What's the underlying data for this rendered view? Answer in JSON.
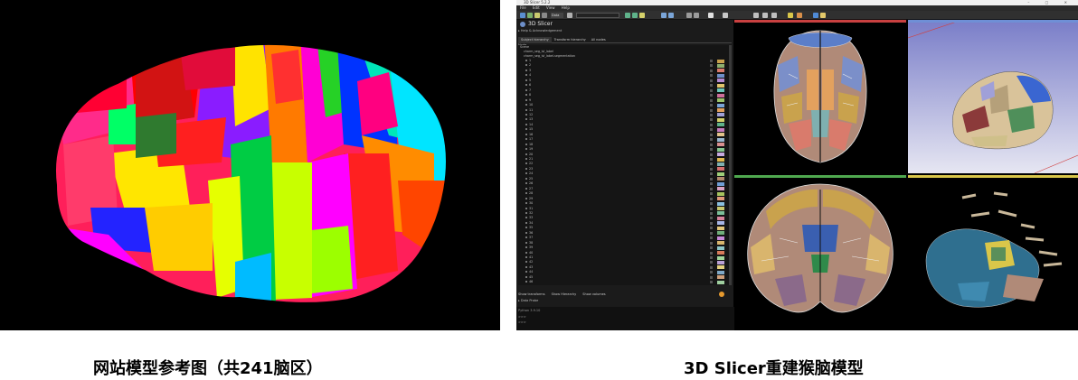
{
  "captions": {
    "left": "网站模型参考图（共241脑区）",
    "right": "3D Slicer重建猴脑模型"
  },
  "slicer": {
    "window_title": "3D Slicer 5.2.2",
    "app_name": "3D Slicer",
    "menu": [
      "File",
      "Edit",
      "View",
      "Help"
    ],
    "module_selector": "Data",
    "help_row": "Help & Acknowledgement",
    "module_tabs": [
      "Subject hierarchy",
      "Transform hierarchy",
      "All nodes"
    ],
    "tree_header": "Node",
    "tree_root": "Scene",
    "tree_nodes": [
      "charm_seg_lvl_label",
      "charm_seg_lvl_label-segmentation"
    ],
    "segments": [
      "1",
      "2",
      "3",
      "4",
      "5",
      "6",
      "7",
      "8",
      "9",
      "10",
      "11",
      "12",
      "13",
      "14",
      "15",
      "16",
      "17",
      "18",
      "19",
      "20",
      "21",
      "22",
      "23",
      "24",
      "25",
      "26",
      "27",
      "28",
      "29",
      "30",
      "31",
      "32",
      "33",
      "34",
      "35",
      "36",
      "37",
      "38",
      "39",
      "40",
      "41",
      "42",
      "43",
      "44",
      "45",
      "46"
    ],
    "segment_colors": [
      "#c9a24d",
      "#8fb06e",
      "#d97b6c",
      "#6f8fc9",
      "#b58ad1",
      "#e0c36a",
      "#6cc6b9",
      "#cf6f9a",
      "#9dc46a",
      "#7aa5d8",
      "#e3a15e",
      "#a0a0d8",
      "#d4d06a",
      "#5fb28a",
      "#c77bbf",
      "#e2c28a",
      "#9ab7d0",
      "#d98f8f",
      "#87c78f",
      "#c6a9e0",
      "#e0b84f",
      "#7fb0b0",
      "#d66f6f",
      "#9fd07a",
      "#b38b6d",
      "#6f9fd6",
      "#d9a3c4",
      "#a6c45f",
      "#e09a7a",
      "#8ac0e0",
      "#c9c96e",
      "#7bbf9a",
      "#d7839d",
      "#a7b6e6",
      "#e4c87a",
      "#6fae7a",
      "#c98ad9",
      "#d8b56d",
      "#8fc7c7",
      "#d77a5a",
      "#a2d69a",
      "#b99fd4",
      "#e3d07f",
      "#7fa8c6",
      "#cfa07c",
      "#9fcf9f"
    ],
    "bottom_tabs": [
      "Show transforms",
      "Show Hierarchy",
      "Show volumes"
    ],
    "data_probe": "Data Probe",
    "python_lines": [
      "Python 3.9.10",
      ">>> ",
      ">>> "
    ]
  },
  "colors": {
    "red_slice": "#c94040",
    "green_slice": "#4fa84f",
    "yellow_slice": "#d9c64a",
    "threed_bg_top": "#7b7fc9",
    "threed_bg_bottom": "#e6e6f2"
  }
}
